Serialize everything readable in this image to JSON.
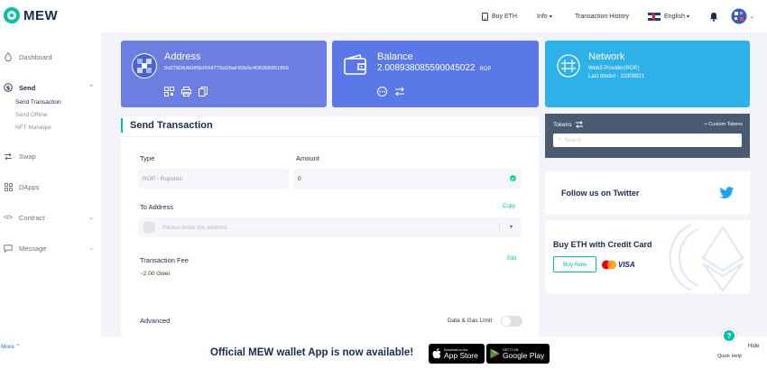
{
  "header": {
    "logo_text": "MEW",
    "buy_eth": "Buy ETH",
    "info": "Info",
    "transaction_history": "Transaction History",
    "language": "English"
  },
  "sidebar": {
    "items": [
      {
        "label": "Dashboard",
        "icon": "droplet-icon"
      },
      {
        "label": "Send",
        "icon": "dollar-circle-icon"
      },
      {
        "label": "Swap",
        "icon": "swap-icon"
      },
      {
        "label": "DApps",
        "icon": "dapps-grid-icon"
      },
      {
        "label": "Contract",
        "icon": "code-icon"
      },
      {
        "label": "Message",
        "icon": "message-icon"
      }
    ],
    "send_sub": [
      "Send Transaction",
      "Send Offline",
      "NFT Manager"
    ],
    "more": "More"
  },
  "cards": {
    "address": {
      "title": "Address",
      "value": "0x276D6A69f5Ef504773aD6aF65b5c40835B951856"
    },
    "balance": {
      "title": "Balance",
      "value": "2.008938085590045022",
      "unit": "ROP"
    },
    "network": {
      "title": "Network",
      "provider": "Web3 Provider(ROP)",
      "last_block": "Last block# : 10309921"
    }
  },
  "send": {
    "title": "Send Transaction",
    "type_label": "Type",
    "type_value": "ROP - Ropsten",
    "amount_label": "Amount",
    "amount_value": "0",
    "to_label": "To Address",
    "copy": "Copy",
    "to_placeholder": "Please enter the address",
    "fee_label": "Transaction Fee",
    "edit": "Edit",
    "fee_value": "~2.00 Gwei",
    "advanced": "Advanced",
    "data_gas": "Data & Gas Limit"
  },
  "tokens": {
    "label": "Tokens",
    "custom": "+ Custom Tokens",
    "search_placeholder": "Search"
  },
  "twitter": {
    "text": "Follow us on Twitter"
  },
  "buy_card": {
    "title": "Buy ETH with Credit Card",
    "button": "Buy Now",
    "visa": "VISA"
  },
  "footer": {
    "banner": "Official MEW wallet App is now available!",
    "app_store_small": "Download on the",
    "app_store_big": "App Store",
    "google_small": "GET IT ON",
    "google_big": "Google Play",
    "quick_help": "Quick Help",
    "hide": "Hide"
  },
  "colors": {
    "address_card": "#6c7fe0",
    "balance_card": "#5a78e8",
    "network_card": "#2eb0e8",
    "accent": "#05c0a5",
    "tokens_header": "#4a5a70"
  }
}
